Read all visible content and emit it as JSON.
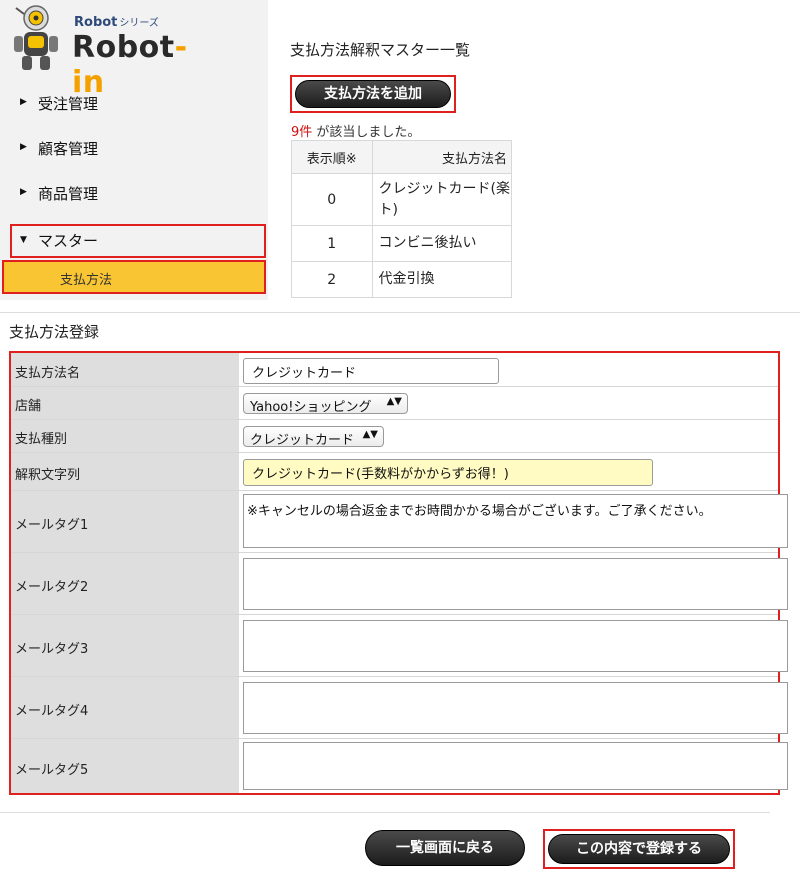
{
  "logo": {
    "series_text": "Robot",
    "series_suffix": "シリーズ",
    "name_main": "Robot",
    "name_dash": "-",
    "name_suffix": "in"
  },
  "sidebar": {
    "items": [
      {
        "label": "受注管理",
        "arrow": "▶"
      },
      {
        "label": "顧客管理",
        "arrow": "▶"
      },
      {
        "label": "商品管理",
        "arrow": "▶"
      },
      {
        "label": "マスター",
        "arrow": "▼"
      }
    ],
    "subitem": "支払方法"
  },
  "main": {
    "title": "支払方法解釈マスター一覧",
    "add_button": "支払方法を追加",
    "count": "9件",
    "count_suffix": " が該当しました。",
    "table": {
      "headers": [
        "表示順※",
        "支払方法名"
      ],
      "rows": [
        {
          "order": "0",
          "name": "クレジットカード(楽ト)"
        },
        {
          "order": "1",
          "name": "コンビニ後払い"
        },
        {
          "order": "2",
          "name": "代金引換"
        }
      ]
    }
  },
  "form": {
    "title": "支払方法登録",
    "fields": {
      "name_label": "支払方法名",
      "name_value": "クレジットカード",
      "shop_label": "店舗",
      "shop_value": "Yahoo!ショッピング",
      "type_label": "支払種別",
      "type_value": "クレジットカード",
      "parse_label": "解釈文字列",
      "parse_value": "クレジットカード(手数料がかからずお得！)",
      "mailtag1_label": "メールタグ1",
      "mailtag1_value": "※キャンセルの場合返金までお時間かかる場合がございます。ご了承ください。",
      "mailtag2_label": "メールタグ2",
      "mailtag2_value": "",
      "mailtag3_label": "メールタグ3",
      "mailtag3_value": "",
      "mailtag4_label": "メールタグ4",
      "mailtag4_value": "",
      "mailtag5_label": "メールタグ5",
      "mailtag5_value": ""
    },
    "select_arrow": "▲▼"
  },
  "footer": {
    "back_button": "一覧画面に戻る",
    "register_button": "この内容で登録する"
  },
  "colors": {
    "highlight_border": "#e0201e",
    "active_menu": "#f9c532",
    "parse_field_bg": "#fffbc2",
    "count_text": "#cc1111"
  }
}
